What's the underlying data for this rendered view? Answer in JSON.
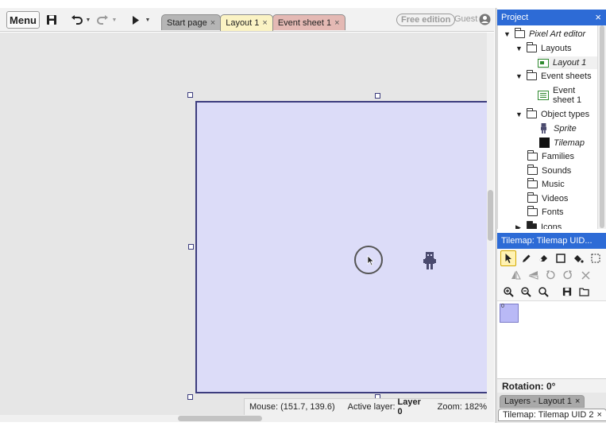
{
  "toolbar": {
    "menu_label": "Menu",
    "free_edition": "Free edition",
    "guest": "Guest"
  },
  "tabs": [
    {
      "label": "Start page",
      "close": "×"
    },
    {
      "label": "Layout 1",
      "close": "×"
    },
    {
      "label": "Event sheet 1",
      "close": "×"
    }
  ],
  "status": {
    "mouse": "Mouse: (151.7, 139.6)",
    "active_layer_label": "Active layer:",
    "active_layer_value": "Layer 0",
    "zoom": "Zoom: 182%"
  },
  "project": {
    "title": "Project",
    "close": "×",
    "root": "Pixel Art editor",
    "layouts_folder": "Layouts",
    "layout_item": "Layout 1",
    "event_sheets_folder": "Event sheets",
    "event_sheet_item_line1": "Event",
    "event_sheet_item_line2": "sheet 1",
    "object_types_folder": "Object types",
    "sprite_item": "Sprite",
    "tilemap_item": "Tilemap",
    "families": "Families",
    "sounds": "Sounds",
    "music": "Music",
    "videos": "Videos",
    "fonts": "Fonts",
    "icons": "Icons"
  },
  "tilemap_panel": {
    "title": "Tilemap: Tilemap UID...",
    "tile_index": "0",
    "rotation": "Rotation: 0°"
  },
  "bottom_tabs": {
    "layers": "Layers - Layout 1",
    "tilemap": "Tilemap: Tilemap UID 2",
    "close": "×"
  },
  "colors": {
    "panel_header": "#2d6bd6",
    "layout_fill": "#dcdcf8",
    "layout_border": "#3d3d7e",
    "tab_layout": "#fbf3c4",
    "tab_event": "#e4b9b4"
  }
}
